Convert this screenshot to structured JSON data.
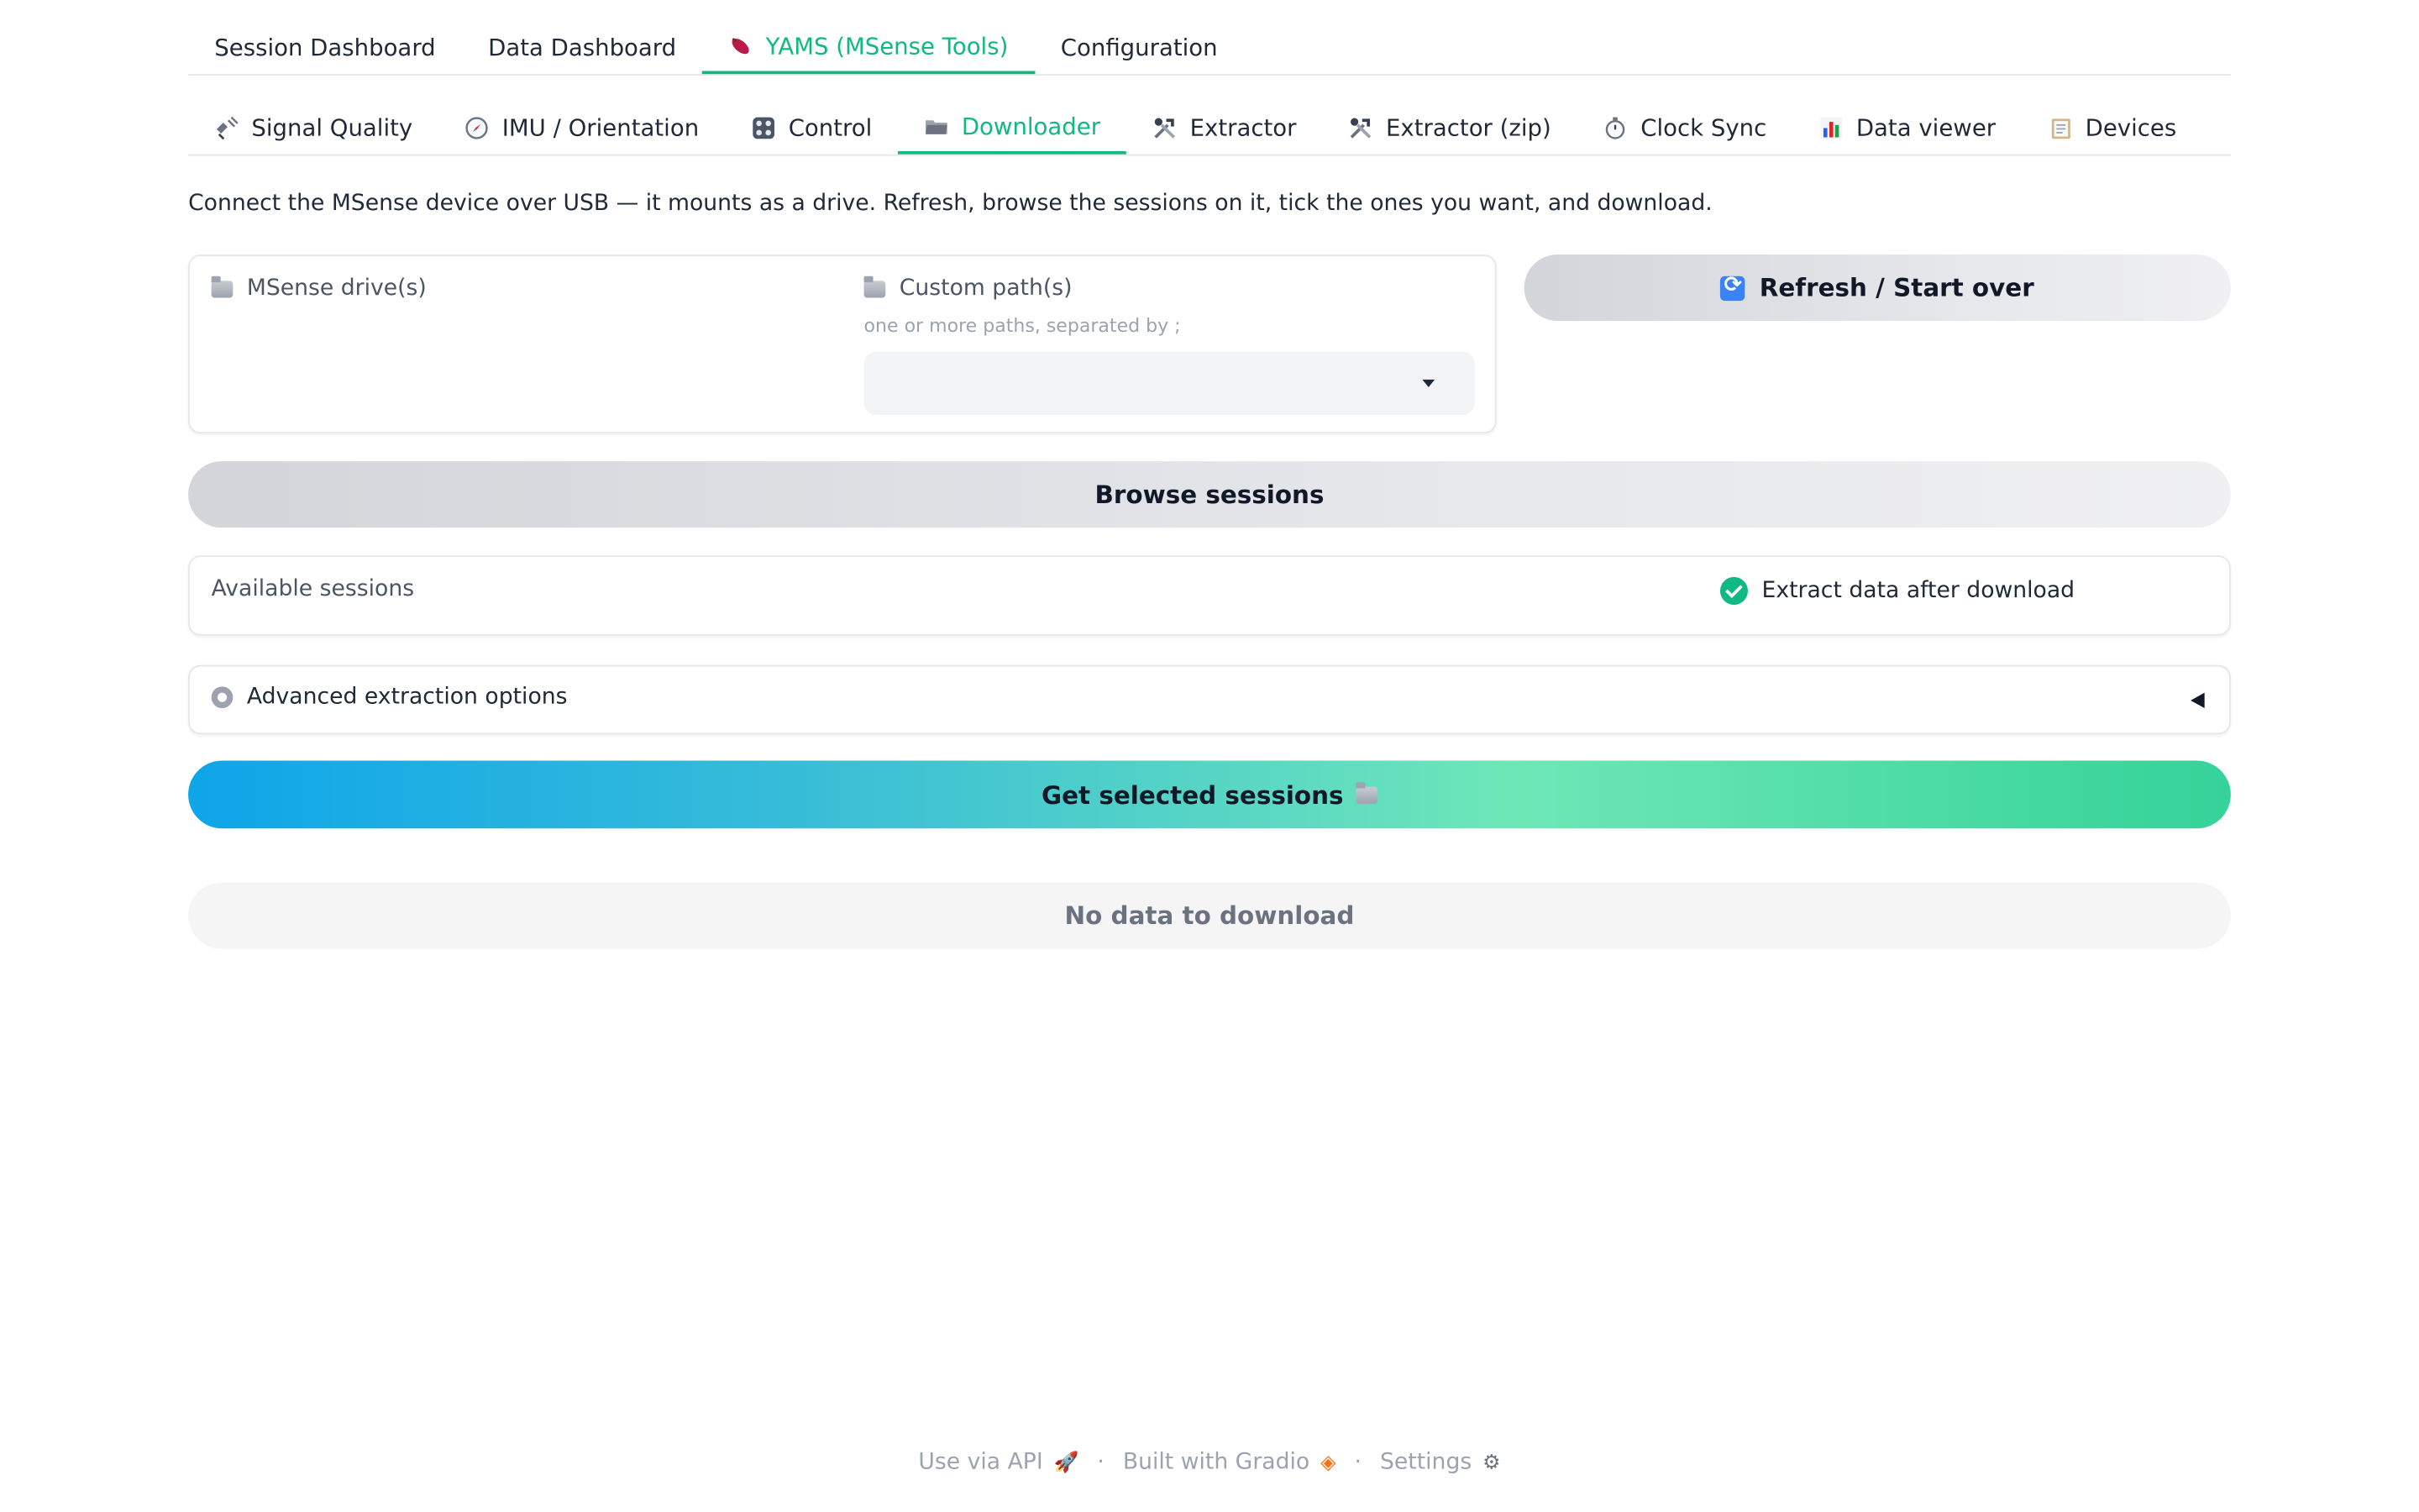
{
  "tabs_top": [
    {
      "label": "Session Dashboard",
      "active": false
    },
    {
      "label": "Data Dashboard",
      "active": false
    },
    {
      "label": "YAMS (MSense Tools)",
      "active": true
    },
    {
      "label": "Configuration",
      "active": false
    }
  ],
  "tabs_sub": [
    {
      "label": "Signal Quality",
      "icon": "satellite-icon",
      "active": false
    },
    {
      "label": "IMU / Orientation",
      "icon": "compass-icon",
      "active": false
    },
    {
      "label": "Control",
      "icon": "control-knobs-icon",
      "active": false
    },
    {
      "label": "Downloader",
      "icon": "folder-icon",
      "active": true
    },
    {
      "label": "Extractor",
      "icon": "tools-icon",
      "active": false
    },
    {
      "label": "Extractor (zip)",
      "icon": "tools-icon",
      "active": false
    },
    {
      "label": "Clock Sync",
      "icon": "stopwatch-icon",
      "active": false
    },
    {
      "label": "Data viewer",
      "icon": "bar-chart-icon",
      "active": false
    },
    {
      "label": "Devices",
      "icon": "clipboard-icon",
      "active": false
    }
  ],
  "intro_text": "Connect the MSense device over USB — it mounts as a drive. Refresh, browse the sessions on it, tick the ones you want, and download.",
  "drive_section": {
    "msense_label": "MSense drive(s)",
    "custom_label": "Custom path(s)",
    "custom_hint": "one or more paths, separated by ;",
    "custom_value": ""
  },
  "refresh_button": "Refresh / Start over",
  "browse_button": "Browse sessions",
  "sessions": {
    "label": "Available sessions",
    "extract_checkbox": "Extract data after download",
    "extract_checked": true
  },
  "advanced": {
    "label": "Advanced extraction options",
    "expanded": false
  },
  "get_button": "Get selected sessions",
  "no_data_text": "No data to download",
  "footer": {
    "api": "Use via API",
    "built": "Built with Gradio",
    "settings": "Settings",
    "separator": "·"
  },
  "colors": {
    "accent": "#10b981",
    "text": "#1f2937",
    "muted": "#9ca3af"
  }
}
